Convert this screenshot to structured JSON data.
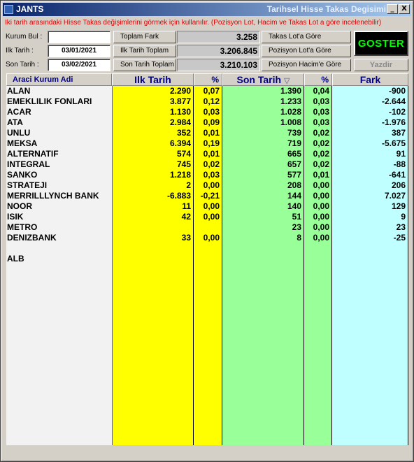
{
  "window": {
    "app_name": "JANTS",
    "caption": "Tarihsel Hisse Takas Degisimi",
    "minimize_glyph": "_",
    "close_glyph": "X"
  },
  "info_text": "Iki tarih arasındaki Hisse Takas değişimlerini görmek için kullanılır. (Pozisyon Lot, Hacim ve Takas Lot a göre incelenebilir)",
  "form": {
    "kurum_label": "Kurum Bul :",
    "kurum_value": "",
    "ilk_label": "Ilk Tarih    :",
    "ilk_value": "03/01/2021",
    "son_label": "Son Tarih  :",
    "son_value": "03/02/2021"
  },
  "summary": [
    {
      "label": "Toplam Fark",
      "value": "3.258"
    },
    {
      "label": "Ilk Tarih Toplam",
      "value": "3.206.845"
    },
    {
      "label": "Son Tarih Toplam",
      "value": "3.210.103"
    }
  ],
  "modes": [
    "Takas Lot'a Göre",
    "Pozisyon Lot'a Göre",
    "Pozisyon Hacim'e Göre"
  ],
  "actions": {
    "goster": "GOSTER",
    "yazdir": "Yazdir"
  },
  "columns": {
    "name": "Araci Kurum Adi",
    "ilk": "Ilk Tarih",
    "ilk_pct": "%",
    "son": "Son Tarih",
    "sort_glyph": "▽",
    "son_pct": "%",
    "fark": "Fark"
  },
  "rows": [
    {
      "name": "ALAN",
      "ilk": "2.290",
      "ilk_pct": "0,07",
      "son": "1.390",
      "son_pct": "0,04",
      "fark": "-900"
    },
    {
      "name": "EMEKLILIK FONLARI",
      "ilk": "3.877",
      "ilk_pct": "0,12",
      "son": "1.233",
      "son_pct": "0,03",
      "fark": "-2.644"
    },
    {
      "name": "ACAR",
      "ilk": "1.130",
      "ilk_pct": "0,03",
      "son": "1.028",
      "son_pct": "0,03",
      "fark": "-102"
    },
    {
      "name": "ATA",
      "ilk": "2.984",
      "ilk_pct": "0,09",
      "son": "1.008",
      "son_pct": "0,03",
      "fark": "-1.976"
    },
    {
      "name": "UNLU",
      "ilk": "352",
      "ilk_pct": "0,01",
      "son": "739",
      "son_pct": "0,02",
      "fark": "387"
    },
    {
      "name": "MEKSA",
      "ilk": "6.394",
      "ilk_pct": "0,19",
      "son": "719",
      "son_pct": "0,02",
      "fark": "-5.675"
    },
    {
      "name": "ALTERNATIF",
      "ilk": "574",
      "ilk_pct": "0,01",
      "son": "665",
      "son_pct": "0,02",
      "fark": "91"
    },
    {
      "name": "INTEGRAL",
      "ilk": "745",
      "ilk_pct": "0,02",
      "son": "657",
      "son_pct": "0,02",
      "fark": "-88"
    },
    {
      "name": "SANKO",
      "ilk": "1.218",
      "ilk_pct": "0,03",
      "son": "577",
      "son_pct": "0,01",
      "fark": "-641"
    },
    {
      "name": "STRATEJI",
      "ilk": "2",
      "ilk_pct": "0,00",
      "son": "208",
      "son_pct": "0,00",
      "fark": "206"
    },
    {
      "name": "MERRILLLYNCH BANK",
      "ilk": "-6.883",
      "ilk_pct": "-0,21",
      "son": "144",
      "son_pct": "0,00",
      "fark": "7.027"
    },
    {
      "name": "NOOR",
      "ilk": "11",
      "ilk_pct": "0,00",
      "son": "140",
      "son_pct": "0,00",
      "fark": "129"
    },
    {
      "name": "ISIK",
      "ilk": "42",
      "ilk_pct": "0,00",
      "son": "51",
      "son_pct": "0,00",
      "fark": "9"
    },
    {
      "name": "METRO",
      "ilk": "",
      "ilk_pct": "",
      "son": "23",
      "son_pct": "0,00",
      "fark": "23"
    },
    {
      "name": "DENIZBANK",
      "ilk": "33",
      "ilk_pct": "0,00",
      "son": "8",
      "son_pct": "0,00",
      "fark": "-25"
    },
    {
      "name": "",
      "ilk": "",
      "ilk_pct": "",
      "son": "",
      "son_pct": "",
      "fark": ""
    },
    {
      "name": "ALB",
      "ilk": "",
      "ilk_pct": "",
      "son": "",
      "son_pct": "",
      "fark": ""
    }
  ]
}
